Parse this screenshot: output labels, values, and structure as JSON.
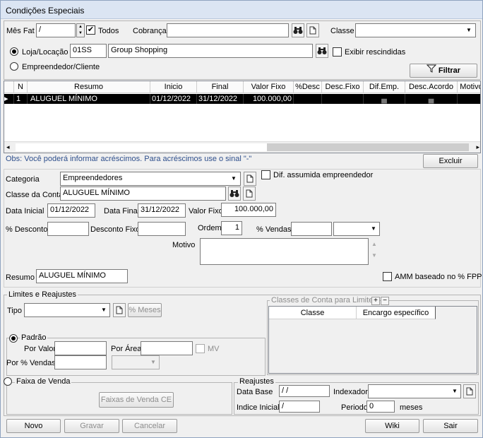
{
  "window": {
    "title": "Condições Especiais"
  },
  "top": {
    "mes_fat_label": "Mês Fat",
    "mes_fat_value": "/",
    "todos_label": "Todos",
    "todos_checked": "✔",
    "cobranca_label": "Cobrança",
    "cobranca_value": "",
    "classe_label": "Classe",
    "classe_value": "",
    "loja_label": "Loja/Locação",
    "loja_code": "01SS",
    "loja_name": "Group Shopping",
    "exibir_rescindidas_label": "Exibir rescindidas",
    "empreendedor_label": "Empreendedor/Cliente",
    "filtrar_label": "Filtrar"
  },
  "grid": {
    "headers": [
      "N",
      "Resumo",
      "Inicio",
      "Final",
      "Valor Fixo",
      "%Desc",
      "Desc.Fixo",
      "Dif.Emp.",
      "Desc.Acordo",
      "Motivo"
    ],
    "rows": [
      {
        "n": "1",
        "resumo": "ALUGUEL MÍNIMO",
        "inicio": "01/12/2022",
        "final": "31/12/2022",
        "valor_fixo": "100.000,00",
        "desc": "",
        "desc_fixo": ""
      }
    ]
  },
  "obs": "Obs: Você poderá informar acréscimos. Para acréscimos use o sinal \"-\"",
  "excluir_label": "Excluir",
  "form": {
    "categoria_label": "Categoria",
    "categoria_value": "Empreendedores",
    "dif_assumida_label": "Dif. assumida empreendedor",
    "classe_conta_label": "Classe da Conta",
    "classe_conta_value": "ALUGUEL MÍNIMO",
    "data_inicial_label": "Data Inicial",
    "data_inicial_value": "01/12/2022",
    "data_final_label": "Data Final",
    "data_final_value": "31/12/2022",
    "valor_fixo_label": "Valor Fixo",
    "valor_fixo_value": "100.000,00",
    "pct_desconto_label": "% Desconto",
    "pct_desconto_value": "",
    "desconto_fixo_label": "Desconto Fixo",
    "desconto_fixo_value": "",
    "ordem_label": "Ordem",
    "ordem_value": "1",
    "pct_vendas_label": "% Vendas",
    "pct_vendas_value": "",
    "motivo_label": "Motivo",
    "motivo_value": "",
    "resumo_label": "Resumo",
    "resumo_value": "ALUGUEL MÍNIMO",
    "amm_label": "AMM baseado no % FPP"
  },
  "limites": {
    "title": "Limites e Reajustes",
    "tipo_label": "Tipo",
    "tipo_value": "",
    "pct_meses_label": "% Meses",
    "classes_title": "Classes de Conta para Limite",
    "classes_headers": [
      "Classe",
      "Encargo específico"
    ],
    "padrao_label": "Padrão",
    "por_valor_label": "Por Valor",
    "por_area_label": "Por Área",
    "mv_label": "MV",
    "por_pct_vendas_label": "Por % Vendas",
    "faixa_venda_label": "Faixa de Venda",
    "faixas_venda_btn": "Faixas de Venda CE",
    "reajustes_title": "Reajustes",
    "data_base_label": "Data Base",
    "data_base_value": "/ /",
    "indexador_label": "Indexador",
    "indexador_value": "",
    "indice_inicial_label": "Indice Inicial",
    "indice_inicial_value": "/",
    "periodo_label": "Periodo",
    "periodo_value": "0",
    "meses_label": "meses"
  },
  "footer": {
    "novo": "Novo",
    "gravar": "Gravar",
    "cancelar": "Cancelar",
    "wiki": "Wiki",
    "sair": "Sair"
  }
}
